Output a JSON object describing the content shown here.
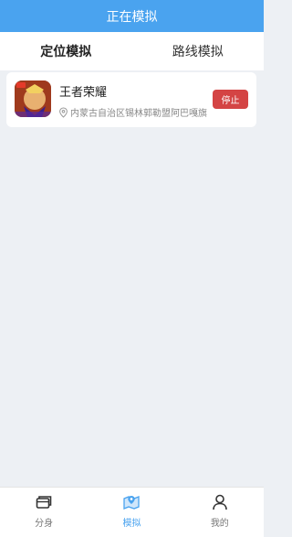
{
  "header": {
    "title": "正在模拟"
  },
  "tabs": [
    {
      "label": "定位模拟",
      "active": true
    },
    {
      "label": "路线模拟",
      "active": false
    }
  ],
  "card": {
    "app_name": "王者荣耀",
    "location": "内蒙古自治区锡林郭勒盟阿巴嘎旗",
    "stop_label": "停止",
    "stop_color": "#d44444"
  },
  "bottom_nav": [
    {
      "label": "分身",
      "icon": "clone-icon",
      "active": false
    },
    {
      "label": "模拟",
      "icon": "map-pin-icon",
      "active": true
    },
    {
      "label": "我的",
      "icon": "user-icon",
      "active": false
    }
  ],
  "colors": {
    "accent": "#4aa3ef",
    "background": "#edf0f4"
  }
}
